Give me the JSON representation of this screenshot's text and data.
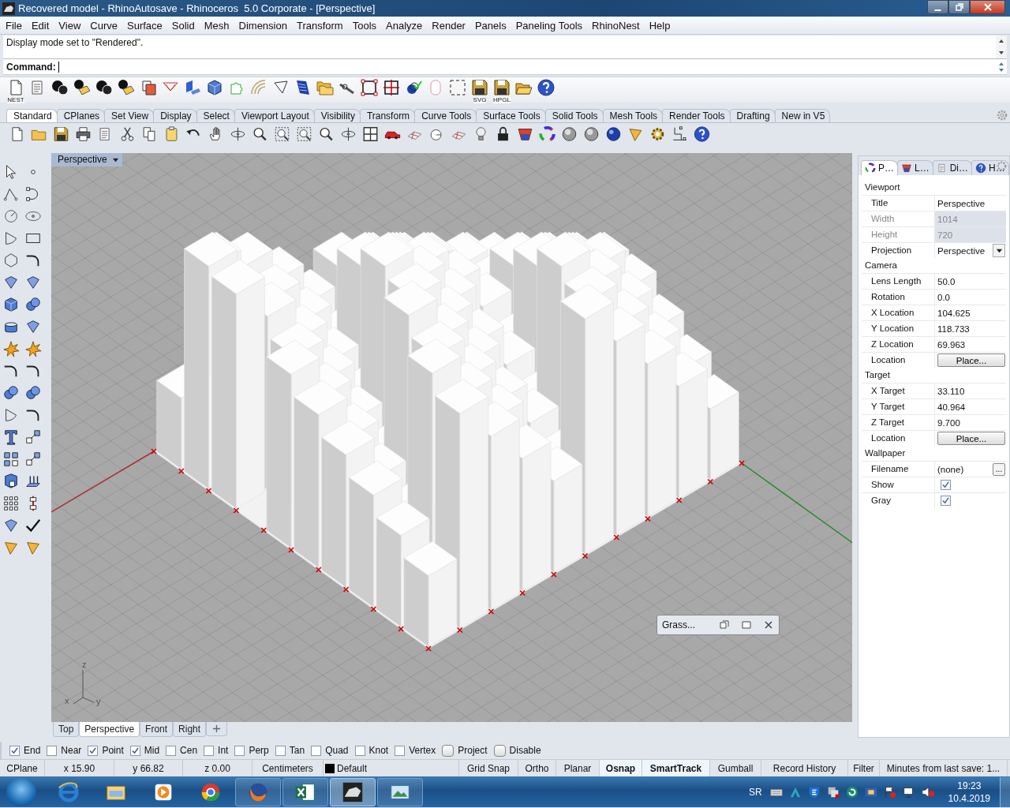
{
  "window": {
    "title": "Recovered model - RhinoAutosave - Rhinoceros  5.0 Corporate - [Perspective]"
  },
  "menu": [
    "File",
    "Edit",
    "View",
    "Curve",
    "Surface",
    "Solid",
    "Mesh",
    "Dimension",
    "Transform",
    "Tools",
    "Analyze",
    "Render",
    "Panels",
    "Paneling Tools",
    "RhinoNest",
    "Help"
  ],
  "command_history": [
    "Display mode set to \"Rendered\"."
  ],
  "command_prompt": "Command:",
  "main_toolbar": {
    "captions": [
      "NEST",
      "SVG",
      "HPGL"
    ]
  },
  "toolbar_tabs": [
    {
      "label": "Standard",
      "selected": true
    },
    {
      "label": "CPlanes",
      "selected": false
    },
    {
      "label": "Set View",
      "selected": false
    },
    {
      "label": "Display",
      "selected": false
    },
    {
      "label": "Select",
      "selected": false
    },
    {
      "label": "Viewport Layout",
      "selected": false
    },
    {
      "label": "Visibility",
      "selected": false
    },
    {
      "label": "Transform",
      "selected": false
    },
    {
      "label": "Curve Tools",
      "selected": false
    },
    {
      "label": "Surface Tools",
      "selected": false
    },
    {
      "label": "Solid Tools",
      "selected": false
    },
    {
      "label": "Mesh Tools",
      "selected": false
    },
    {
      "label": "Render Tools",
      "selected": false
    },
    {
      "label": "Drafting",
      "selected": false
    },
    {
      "label": "New in V5",
      "selected": false
    }
  ],
  "viewport": {
    "title": "Perspective",
    "axis_labels": [
      "z",
      "x",
      "y"
    ],
    "floating_window": {
      "title": "Grass..."
    }
  },
  "viewport_tabs": [
    {
      "label": "Top",
      "selected": false
    },
    {
      "label": "Perspective",
      "selected": true
    },
    {
      "label": "Front",
      "selected": false
    },
    {
      "label": "Right",
      "selected": false
    }
  ],
  "properties_panel": {
    "tabs": [
      {
        "label": "P…",
        "selected": true
      },
      {
        "label": "L…",
        "selected": false
      },
      {
        "label": "Di…",
        "selected": false
      },
      {
        "label": "H…",
        "selected": false
      }
    ],
    "sections": [
      {
        "title": "Viewport",
        "rows": [
          {
            "label": "Title",
            "value": "Perspective",
            "kind": "text",
            "disabled": false
          },
          {
            "label": "Width",
            "value": "1014",
            "kind": "text",
            "disabled": true
          },
          {
            "label": "Height",
            "value": "720",
            "kind": "text",
            "disabled": true
          },
          {
            "label": "Projection",
            "value": "Perspective",
            "kind": "dropdown",
            "disabled": false
          }
        ]
      },
      {
        "title": "Camera",
        "rows": [
          {
            "label": "Lens Length",
            "value": "50.0",
            "kind": "text",
            "disabled": false
          },
          {
            "label": "Rotation",
            "value": "0.0",
            "kind": "text",
            "disabled": false
          },
          {
            "label": "X Location",
            "value": "104.625",
            "kind": "text",
            "disabled": false
          },
          {
            "label": "Y Location",
            "value": "118.733",
            "kind": "text",
            "disabled": false
          },
          {
            "label": "Z Location",
            "value": "69.963",
            "kind": "text",
            "disabled": false
          },
          {
            "label": "Location",
            "value": "Place...",
            "kind": "button",
            "disabled": false
          }
        ]
      },
      {
        "title": "Target",
        "rows": [
          {
            "label": "X Target",
            "value": "33.110",
            "kind": "text",
            "disabled": false
          },
          {
            "label": "Y Target",
            "value": "40.964",
            "kind": "text",
            "disabled": false
          },
          {
            "label": "Z Target",
            "value": "9.700",
            "kind": "text",
            "disabled": false
          },
          {
            "label": "Location",
            "value": "Place...",
            "kind": "button",
            "disabled": false
          }
        ]
      },
      {
        "title": "Wallpaper",
        "rows": [
          {
            "label": "Filename",
            "value": "(none)",
            "button_label": "...",
            "kind": "file",
            "disabled": false
          },
          {
            "label": "Show",
            "checked": true,
            "kind": "checkbox",
            "disabled": false
          },
          {
            "label": "Gray",
            "checked": true,
            "kind": "checkbox",
            "disabled": false
          }
        ]
      }
    ]
  },
  "osnaps": [
    {
      "label": "End",
      "checked": true,
      "kind": "box"
    },
    {
      "label": "Near",
      "checked": false,
      "kind": "box"
    },
    {
      "label": "Point",
      "checked": true,
      "kind": "box"
    },
    {
      "label": "Mid",
      "checked": true,
      "kind": "box"
    },
    {
      "label": "Cen",
      "checked": false,
      "kind": "box"
    },
    {
      "label": "Int",
      "checked": false,
      "kind": "box"
    },
    {
      "label": "Perp",
      "checked": false,
      "kind": "box"
    },
    {
      "label": "Tan",
      "checked": false,
      "kind": "box"
    },
    {
      "label": "Quad",
      "checked": false,
      "kind": "box"
    },
    {
      "label": "Knot",
      "checked": false,
      "kind": "box"
    },
    {
      "label": "Vertex",
      "checked": false,
      "kind": "box"
    },
    {
      "label": "Project",
      "checked": false,
      "kind": "round"
    },
    {
      "label": "Disable",
      "checked": false,
      "kind": "round"
    }
  ],
  "status_bar": [
    {
      "label": "CPlane",
      "kind": "text"
    },
    {
      "label": "x 15.90",
      "kind": "text"
    },
    {
      "label": "y 66.82",
      "kind": "text"
    },
    {
      "label": "z 0.00",
      "kind": "text"
    },
    {
      "label": "Centimeters",
      "kind": "text"
    },
    {
      "label": "Default",
      "kind": "layer"
    },
    {
      "label": "Grid Snap",
      "kind": "toggle",
      "on": false
    },
    {
      "label": "Ortho",
      "kind": "toggle",
      "on": false
    },
    {
      "label": "Planar",
      "kind": "toggle",
      "on": false
    },
    {
      "label": "Osnap",
      "kind": "toggle",
      "on": true
    },
    {
      "label": "SmartTrack",
      "kind": "toggle",
      "on": true
    },
    {
      "label": "Gumball",
      "kind": "toggle",
      "on": false
    },
    {
      "label": "Record History",
      "kind": "toggle",
      "on": false
    },
    {
      "label": "Filter",
      "kind": "toggle",
      "on": false
    },
    {
      "label": "Minutes from last save: 1...",
      "kind": "text"
    }
  ],
  "taskbar": {
    "apps": [
      {
        "running": false,
        "selected": false
      },
      {
        "running": false,
        "selected": false
      },
      {
        "running": false,
        "selected": false
      },
      {
        "running": false,
        "selected": false
      },
      {
        "running": true,
        "selected": false
      },
      {
        "running": true,
        "selected": false
      },
      {
        "running": true,
        "selected": true
      },
      {
        "running": true,
        "selected": false
      }
    ],
    "tray": {
      "language": "SR",
      "time": "19:23",
      "date": "10.4.2019"
    }
  }
}
